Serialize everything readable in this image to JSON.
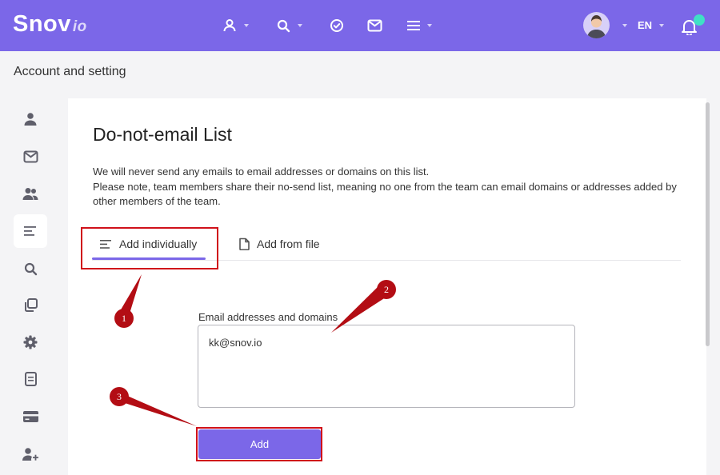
{
  "app": {
    "logo_main": "Snov",
    "logo_suffix": "io",
    "language": "EN"
  },
  "page": {
    "header": "Account and setting"
  },
  "content": {
    "title": "Do-not-email List",
    "desc_line1": "We will never send any emails to email addresses or domains on this list.",
    "desc_line2": "Please note, team members share their no-send list, meaning no one from the team can email domains or addresses added by other members of the team.",
    "tabs": [
      {
        "label": "Add individually",
        "active": true
      },
      {
        "label": "Add from file",
        "active": false
      }
    ],
    "field_label": "Email addresses and domains",
    "field_value": "kk@snov.io",
    "add_button": "Add"
  },
  "annotations": {
    "badges": [
      "1",
      "2",
      "3"
    ]
  },
  "colors": {
    "brand": "#7b67e8",
    "highlight": "#d0111a",
    "badge": "#b30d14",
    "notification": "#3fe0c5"
  },
  "icons": {
    "topnav": [
      "user-icon",
      "search-icon",
      "check-circle-icon",
      "mail-icon",
      "menu-icon"
    ],
    "sidebar": [
      "user-icon",
      "mail-icon",
      "team-icon",
      "list-icon",
      "search-icon",
      "copy-icon",
      "gear-icon",
      "document-icon",
      "credit-card-icon",
      "add-user-icon"
    ]
  }
}
